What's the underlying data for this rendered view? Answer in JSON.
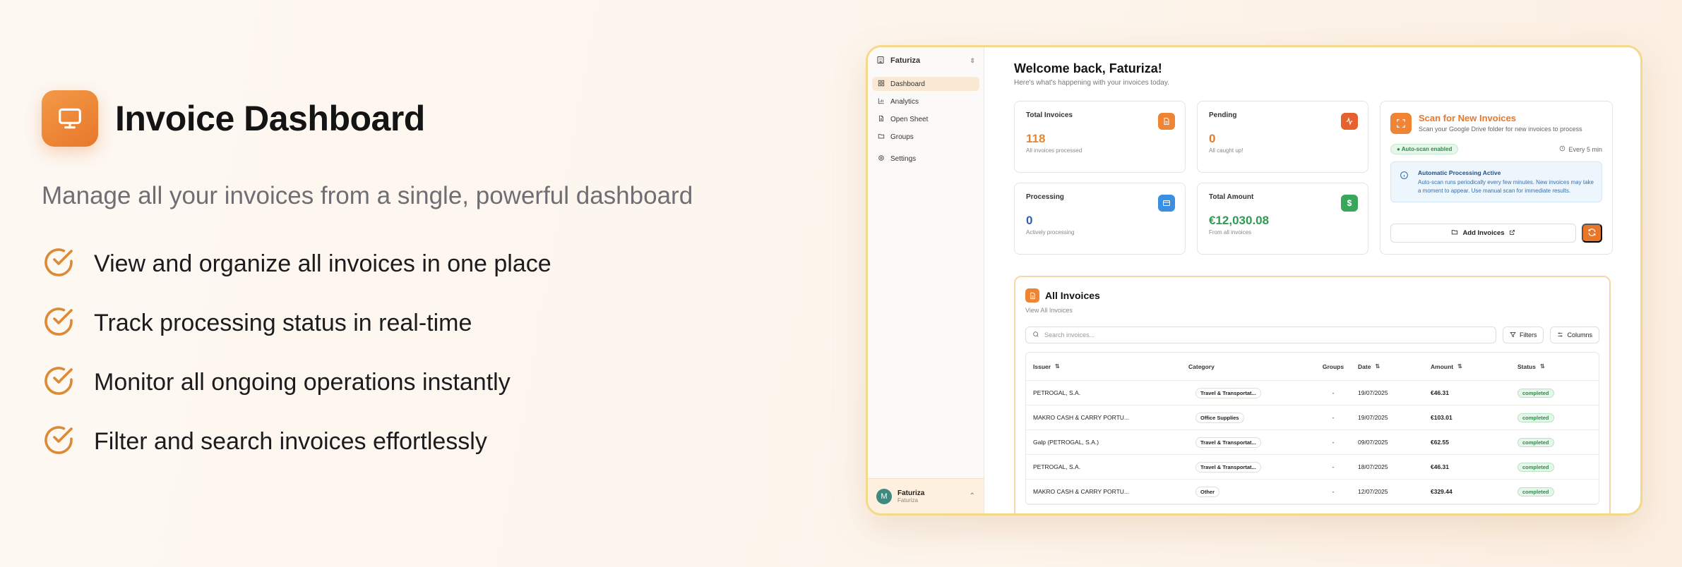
{
  "promo": {
    "title": "Invoice Dashboard",
    "subtitle": "Manage all your invoices from a single, powerful dashboard",
    "features": [
      "View and organize all invoices in one place",
      "Track processing status in real-time",
      "Monitor all ongoing operations instantly",
      "Filter and search invoices effortlessly"
    ]
  },
  "app": {
    "workspace": "Faturiza",
    "nav": [
      "Dashboard",
      "Analytics",
      "Open Sheet",
      "Groups",
      "Settings"
    ],
    "user": {
      "initial": "M",
      "name": "Faturiza",
      "sub": "Faturiza"
    },
    "welcome": "Welcome back, Faturiza!",
    "welcome_sub": "Here's what's happening with your invoices today.",
    "stats": [
      {
        "label": "Total Invoices",
        "value": "118",
        "sub": "All invoices processed",
        "color": "#e8862f"
      },
      {
        "label": "Pending",
        "value": "0",
        "sub": "All caught up!",
        "color": "#e8772a"
      },
      {
        "label": "Processing",
        "value": "0",
        "sub": "Actively processing",
        "color": "#2e5fb0"
      },
      {
        "label": "Total Amount",
        "value": "€12,030.08",
        "sub": "From all invoices",
        "color": "#2f9a52"
      }
    ],
    "scan": {
      "title": "Scan for New Invoices",
      "sub": "Scan your Google Drive folder for new invoices to process",
      "badge": "Auto-scan enabled",
      "every": "Every 5 min",
      "info_title": "Automatic Processing Active",
      "info_text": "Auto-scan runs periodically every few minutes. New invoices may take a moment to appear. Use manual scan for immediate results.",
      "add_label": "Add Invoices"
    },
    "invoices": {
      "title": "All Invoices",
      "link": "View All Invoices",
      "search_placeholder": "Search invoices...",
      "filters": "Filters",
      "columns_btn": "Columns",
      "headers": [
        "Issuer",
        "Category",
        "Groups",
        "Date",
        "Amount",
        "Status"
      ],
      "rows": [
        {
          "issuer": "PETROGAL, S.A.",
          "category": "Travel & Transportat...",
          "groups": "-",
          "date": "19/07/2025",
          "amount": "€46.31",
          "status": "completed"
        },
        {
          "issuer": "MAKRO CASH & CARRY PORTU...",
          "category": "Office Supplies",
          "groups": "-",
          "date": "19/07/2025",
          "amount": "€103.01",
          "status": "completed"
        },
        {
          "issuer": "Galp (PETROGAL, S.A.)",
          "category": "Travel & Transportat...",
          "groups": "-",
          "date": "09/07/2025",
          "amount": "€62.55",
          "status": "completed"
        },
        {
          "issuer": "PETROGAL, S.A.",
          "category": "Travel & Transportat...",
          "groups": "-",
          "date": "18/07/2025",
          "amount": "€46.31",
          "status": "completed"
        },
        {
          "issuer": "MAKRO CASH & CARRY PORTU...",
          "category": "Other",
          "groups": "-",
          "date": "12/07/2025",
          "amount": "€329.44",
          "status": "completed"
        }
      ]
    }
  }
}
